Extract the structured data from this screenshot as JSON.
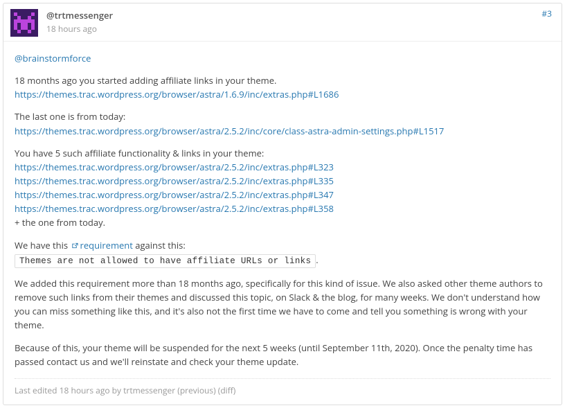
{
  "header": {
    "author": "@trtmessenger",
    "timestamp": "18 hours ago",
    "number": "#3"
  },
  "body": {
    "mention": "@brainstormforce",
    "p1_text": "18 months ago you started adding affiliate links in your theme.",
    "link1": "https://themes.trac.wordpress.org/browser/astra/1.6.9/inc/extras.php#L1686",
    "p2_text": "The last one is from today:",
    "link2": "https://themes.trac.wordpress.org/browser/astra/2.5.2/inc/core/class-astra-admin-settings.php#L1517",
    "p3_text": "You have 5 such affiliate functionality & links in your theme:",
    "link3a": "https://themes.trac.wordpress.org/browser/astra/2.5.2/inc/extras.php#L323",
    "link3b": "https://themes.trac.wordpress.org/browser/astra/2.5.2/inc/extras.php#L335",
    "link3c": "https://themes.trac.wordpress.org/browser/astra/2.5.2/inc/extras.php#L347",
    "link3d": "https://themes.trac.wordpress.org/browser/astra/2.5.2/inc/extras.php#L358",
    "p3_tail": "+ the one from today.",
    "p4_pre": "We have this ",
    "p4_link": "requirement",
    "p4_post": " against this:",
    "code": "Themes are not allowed to have affiliate URLs or links",
    "p5": "We added this requirement more than 18 months ago, specifically for this kind of issue. We also asked other theme authors to remove such links from their themes and discussed this topic, on Slack & the blog, for many weeks. We don't understand how you can miss something like this, and it's also not the first time we have to come and tell you something is wrong with your theme.",
    "p6": "Because of this, your theme will be suspended for the next 5 weeks (until September 11th, 2020). Once the penalty time has passed contact us and we'll reinstate and check your theme update."
  },
  "footer": {
    "t1": "Last edited ",
    "time": "18 hours ago",
    "t2": " by trtmessenger (",
    "prev": "previous",
    "t3": ") (",
    "diff": "diff",
    "t4": ")"
  }
}
